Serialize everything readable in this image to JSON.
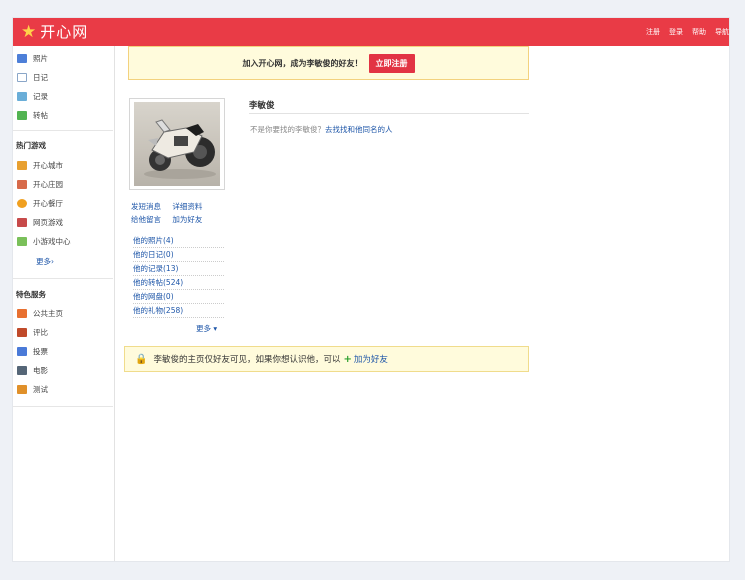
{
  "brand": {
    "logo_text": "开心网"
  },
  "top_links": [
    "注册",
    "登录",
    "帮助",
    "导航"
  ],
  "sidebar": {
    "apps": [
      {
        "label": "照片",
        "icon": "photo-icon",
        "color": "#4d7fd8"
      },
      {
        "label": "日记",
        "icon": "diary-icon",
        "color": "#8aa6c8"
      },
      {
        "label": "记录",
        "icon": "record-icon",
        "color": "#6aaed8"
      },
      {
        "label": "转帖",
        "icon": "repost-icon",
        "color": "#52b452"
      }
    ],
    "games_heading": "热门游戏",
    "games": [
      {
        "label": "开心城市",
        "icon": "city-icon",
        "color": "#e8a030"
      },
      {
        "label": "开心庄园",
        "icon": "farm-icon",
        "color": "#d76a4a"
      },
      {
        "label": "开心餐厅",
        "icon": "restaurant-icon",
        "color": "#f0a020"
      },
      {
        "label": "网页游戏",
        "icon": "webgame-icon",
        "color": "#c74a4a"
      },
      {
        "label": "小游戏中心",
        "icon": "minigame-icon",
        "color": "#7ac05a"
      }
    ],
    "games_more": "更多›",
    "services_heading": "特色服务",
    "services": [
      {
        "label": "公共主页",
        "icon": "public-page-icon",
        "color": "#e87030"
      },
      {
        "label": "评比",
        "icon": "vote-icon",
        "color": "#c04a2a"
      },
      {
        "label": "投票",
        "icon": "poll-icon",
        "color": "#4a7ad8"
      },
      {
        "label": "电影",
        "icon": "movie-icon",
        "color": "#556677"
      },
      {
        "label": "测试",
        "icon": "test-icon",
        "color": "#e0902a"
      }
    ]
  },
  "join_bar": {
    "text": "加入开心网，成为李敏俊的好友！",
    "button": "立即注册"
  },
  "profile": {
    "name": "李敏俊",
    "not_text": "不是你要找的李敏俊？",
    "not_link": "去找找和他同名的人",
    "actions_row1": [
      "发短消息",
      "详细资料"
    ],
    "actions_row2": [
      "给他留言",
      "加为好友"
    ],
    "lists": [
      "他的照片(4)",
      "他的日记(0)",
      "他的记录(13)",
      "他的转帖(524)",
      "他的网盘(0)",
      "他的礼物(258)"
    ],
    "more": "更多 ▾"
  },
  "notice": {
    "text": "李敏俊的主页仅好友可见，如果你想认识他，可以",
    "link": "加为好友"
  }
}
